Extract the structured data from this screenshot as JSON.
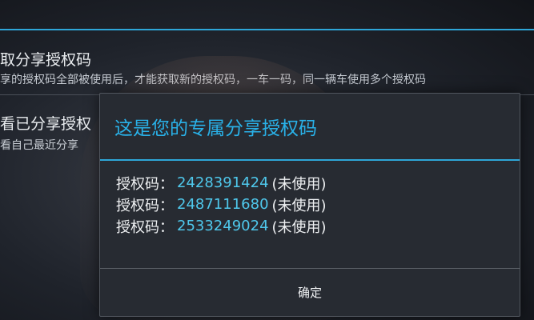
{
  "background": {
    "item1_title": "取分享授权码",
    "item1_subtitle": "享的授权码全部被使用后，才能获取新的授权码，一车一码，同一辆车使用多个授权码",
    "item2_title": "看已分享授权",
    "item2_subtitle": "看自己最近分享"
  },
  "dialog": {
    "title": "这是您的专属分享授权码",
    "codes": [
      {
        "label": "授权码：",
        "value": "2428391424",
        "status": "(未使用)"
      },
      {
        "label": "授权码：",
        "value": "2487111680",
        "status": "(未使用)"
      },
      {
        "label": "授权码：",
        "value": "2533249024",
        "status": "(未使用)"
      }
    ],
    "confirm_label": "确定"
  },
  "colors": {
    "accent": "#2ea6d8",
    "code_value": "#4fc8ec",
    "dialog_bg": "#272b32"
  }
}
